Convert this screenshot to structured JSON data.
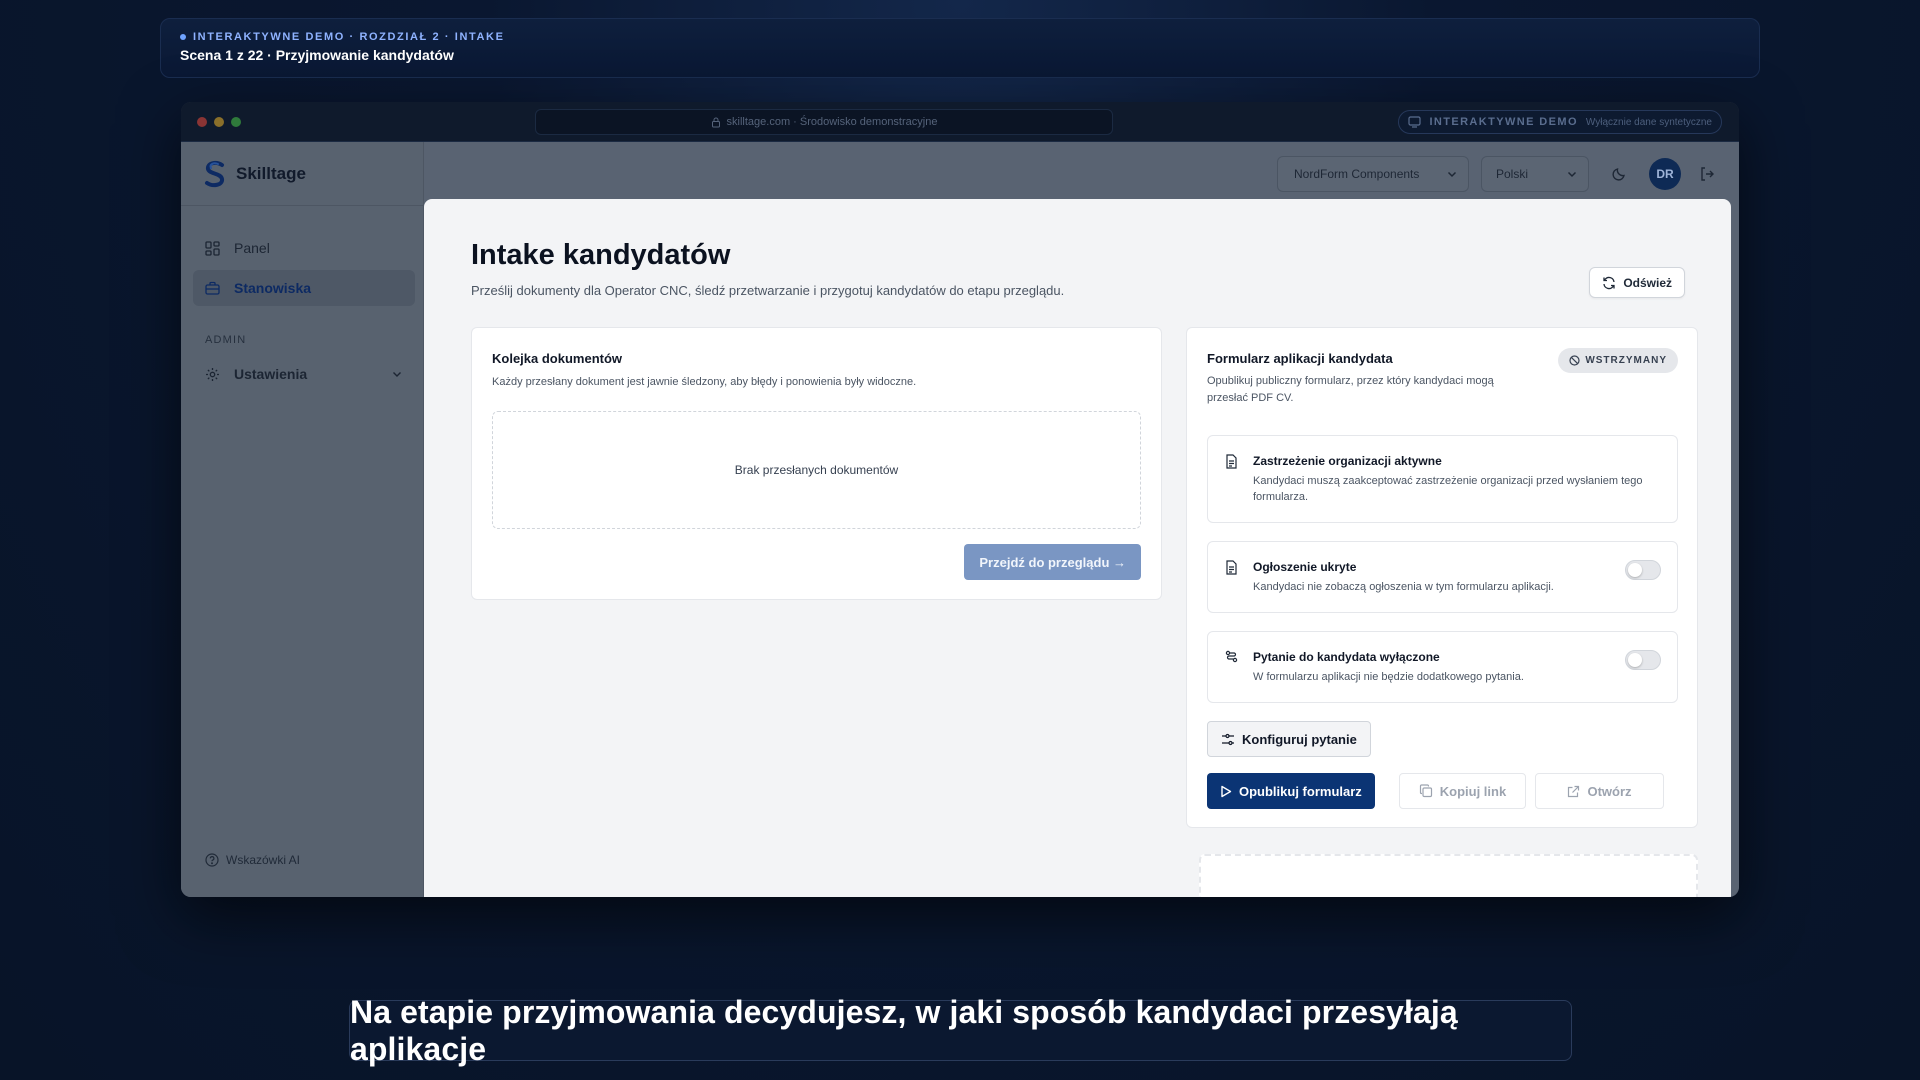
{
  "banner": {
    "kicker": "INTERAKTYWNE DEMO · ROZDZIAŁ 2 · INTAKE",
    "scene": "Scena 1 z 22 · Przyjmowanie kandydatów"
  },
  "browser": {
    "url": "skilltage.com · Środowisko demonstracyjne",
    "demo_label": "INTERAKTYWNE DEMO",
    "demo_note": "Wyłącznie dane syntetyczne"
  },
  "app": {
    "brand": "Skilltage",
    "nav": [
      {
        "label": "Panel",
        "icon": "grid-icon"
      },
      {
        "label": "Stanowiska",
        "icon": "briefcase-icon",
        "active": true
      }
    ],
    "section_label": "ADMIN",
    "settings_label": "Ustawienia",
    "ai_tips": "Wskazówki AI",
    "company_select": "NordForm Components",
    "language_select": "Polski",
    "avatar_initials": "DR"
  },
  "page": {
    "title": "Intake kandydatów",
    "subtitle": "Prześlij dokumenty dla Operator CNC, śledź przetwarzanie i przygotuj kandydatów do etapu przeglądu.",
    "refresh_label": "Odśwież"
  },
  "queue": {
    "title": "Kolejka dokumentów",
    "description": "Każdy przesłany dokument jest jawnie śledzony, aby błędy i ponowienia były widoczne.",
    "empty": "Brak przesłanych dokumentów",
    "review_button": "Przejdź do przeglądu →"
  },
  "form": {
    "title": "Formularz aplikacji kandydata",
    "description": "Opublikuj publiczny formularz, przez który kandydaci mogą przesłać PDF CV.",
    "status": "WSTRZYMANY",
    "settings": [
      {
        "title": "Zastrzeżenie organizacji aktywne",
        "desc": "Kandydaci muszą zaakceptować zastrzeżenie organizacji przed wysłaniem tego formularza.",
        "icon": "document-icon",
        "toggle": false
      },
      {
        "title": "Ogłoszenie ukryte",
        "desc": "Kandydaci nie zobaczą ogłoszenia w tym formularzu aplikacji.",
        "icon": "document-icon",
        "toggle": true,
        "toggle_on": false
      },
      {
        "title": "Pytanie do kandydata wyłączone",
        "desc": "W formularzu aplikacji nie będzie dodatkowego pytania.",
        "icon": "question-flow-icon",
        "toggle": true,
        "toggle_on": false
      }
    ],
    "configure_button": "Konfiguruj pytanie",
    "publish_button": "Opublikuj formularz",
    "copy_button": "Kopiuj link",
    "open_button": "Otwórz"
  },
  "caption": "Na etapie przyjmowania decydujesz, w jaki sposób kandydaci przesyłają aplikacje",
  "colors": {
    "primary": "#0b3474",
    "primary_disabled": "#7a96c3",
    "background": "#081428"
  }
}
